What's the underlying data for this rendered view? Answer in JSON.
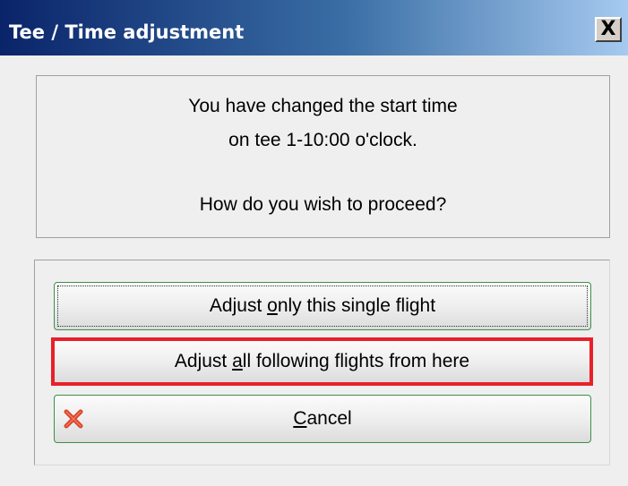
{
  "window": {
    "title": "Tee / Time adjustment",
    "close_label": "X"
  },
  "message": {
    "line1": "You have changed the start time",
    "line2": "on tee 1-10:00 o'clock.",
    "line3": "How do you wish to proceed?"
  },
  "buttons": {
    "single": {
      "prefix": "Adjust ",
      "mnemonic": "o",
      "suffix": "nly this single flight"
    },
    "all": {
      "prefix": "Adjust ",
      "mnemonic": "a",
      "suffix": "ll following flights from here"
    },
    "cancel": {
      "prefix": "",
      "mnemonic": "C",
      "suffix": "ancel"
    }
  },
  "colors": {
    "highlight": "#e8202a",
    "button_border": "#3d8f4b",
    "cancel_icon": "#d9442b"
  },
  "icons": {
    "close": "close-icon",
    "cancel": "red-x-icon"
  }
}
